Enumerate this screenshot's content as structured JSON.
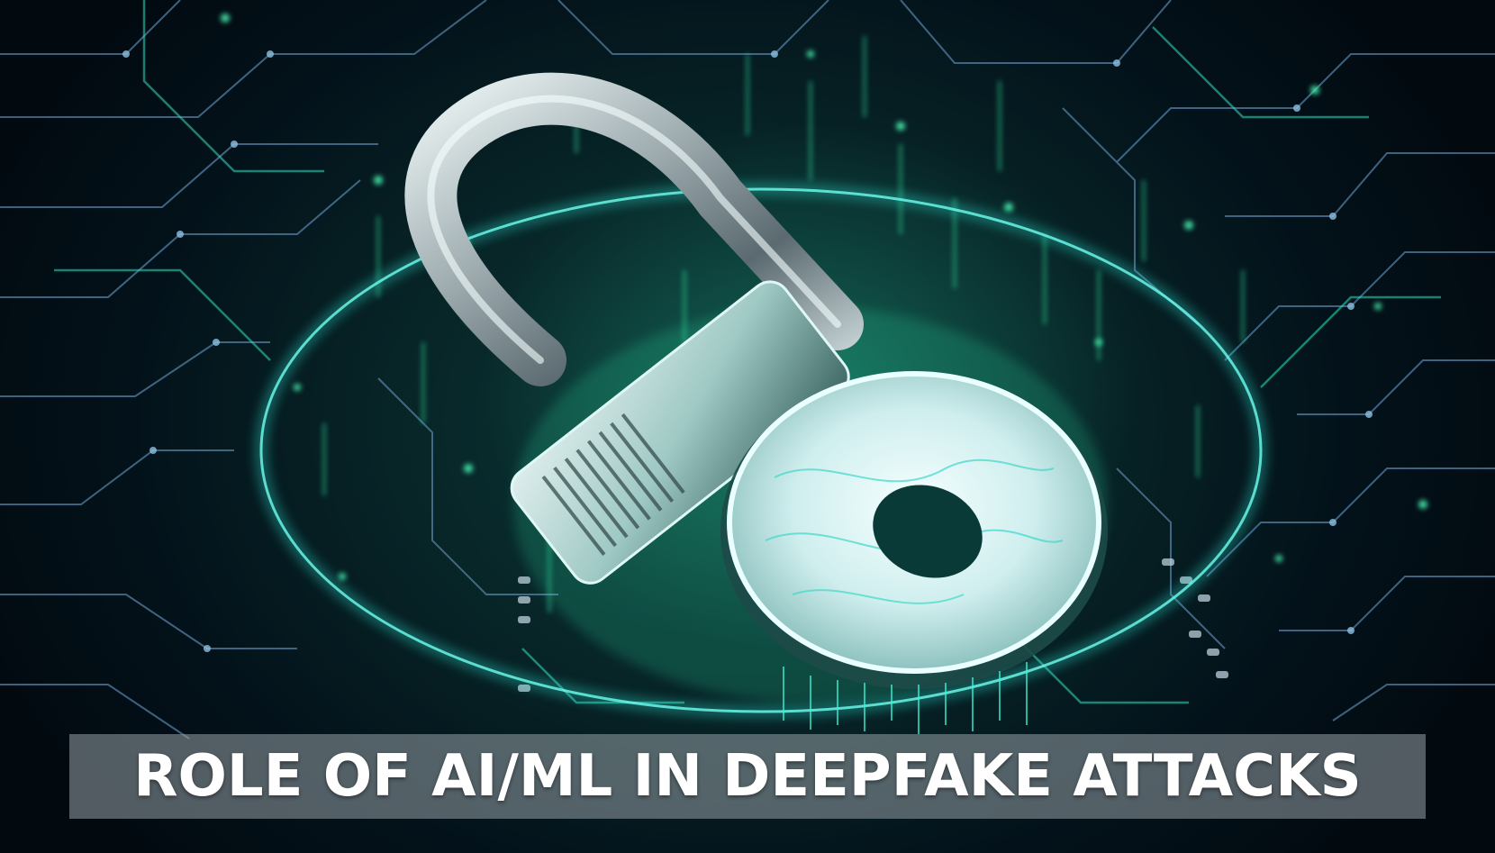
{
  "image": {
    "title": "ROLE OF AI/ML IN DEEPFAKE ATTACKS",
    "main_icon": "padlock-icon",
    "background": "circuit-board",
    "colors": {
      "background_dark": "#03121a",
      "glow_green": "#2cf0a0",
      "ring_cyan": "#30e8d8",
      "circuit_line": "#6fa0c8",
      "metal": "#c8d4d8",
      "banner": "#969fa5",
      "title_text": "#ffffff"
    }
  }
}
